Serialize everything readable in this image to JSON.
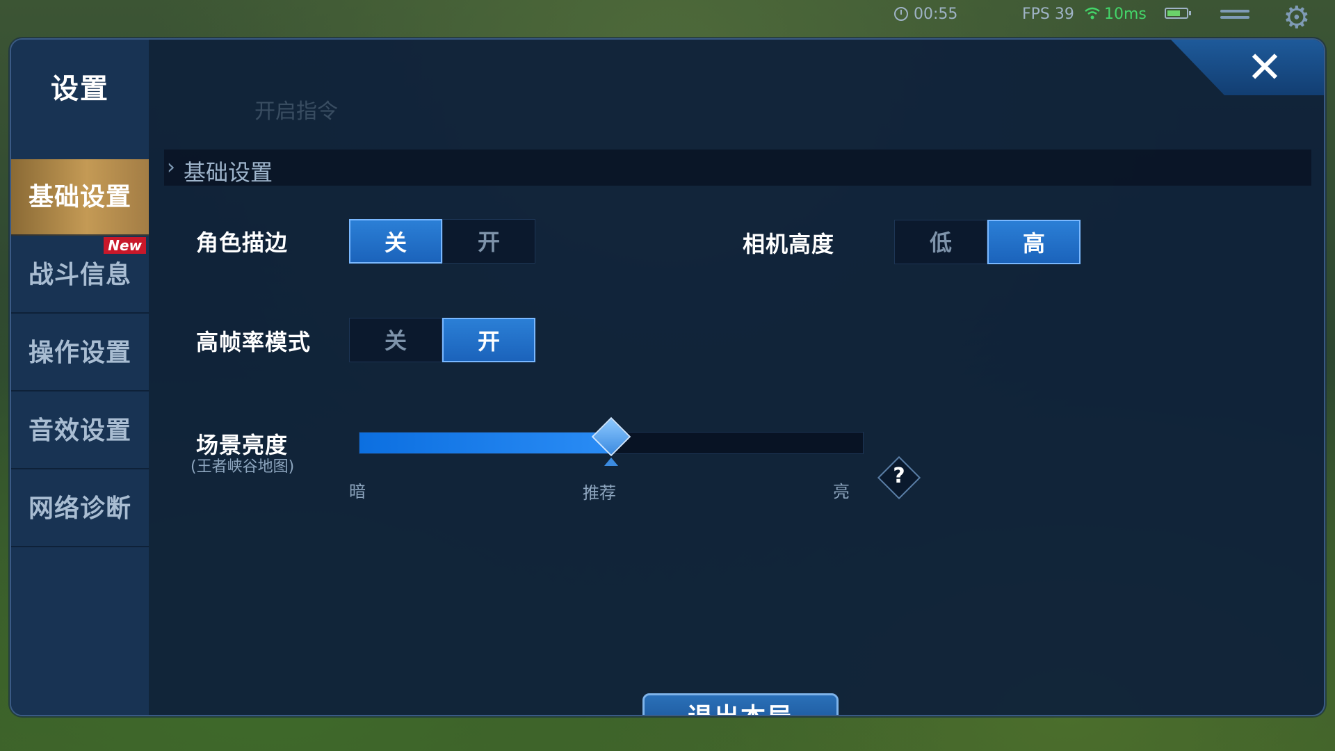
{
  "hud": {
    "timer": "00:55",
    "fps": "FPS 39",
    "ping": "10ms",
    "accent_ping_color": "#44d66a"
  },
  "background": {
    "command_hint": "开启指令"
  },
  "panel": {
    "title": "设置",
    "close_icon": "close-icon"
  },
  "sidebar": {
    "items": [
      {
        "label": "基础设置",
        "active": true
      },
      {
        "label": "战斗信息",
        "badge": "New"
      },
      {
        "label": "操作设置"
      },
      {
        "label": "音效设置"
      },
      {
        "label": "网络诊断"
      }
    ]
  },
  "section": {
    "title": "基础设置"
  },
  "settings": {
    "outline": {
      "label": "角色描边",
      "options": [
        "关",
        "开"
      ],
      "selected": "关"
    },
    "camera_height": {
      "label": "相机高度",
      "options": [
        "低",
        "高"
      ],
      "selected": "高"
    },
    "high_fps": {
      "label": "高帧率模式",
      "options": [
        "关",
        "开"
      ],
      "selected": "开"
    },
    "brightness": {
      "label": "场景亮度",
      "sublabel": "(王者峡谷地图)",
      "min_label": "暗",
      "mid_label": "推荐",
      "max_label": "亮",
      "value": 0.5,
      "help_glyph": "?"
    }
  },
  "footer": {
    "exit_label": "退出本局"
  },
  "colors": {
    "accent_blue": "#2b7fd6",
    "active_tab_gold": "#c49a55",
    "panel_bg": "#0e203a",
    "badge_red": "#c8182a"
  }
}
